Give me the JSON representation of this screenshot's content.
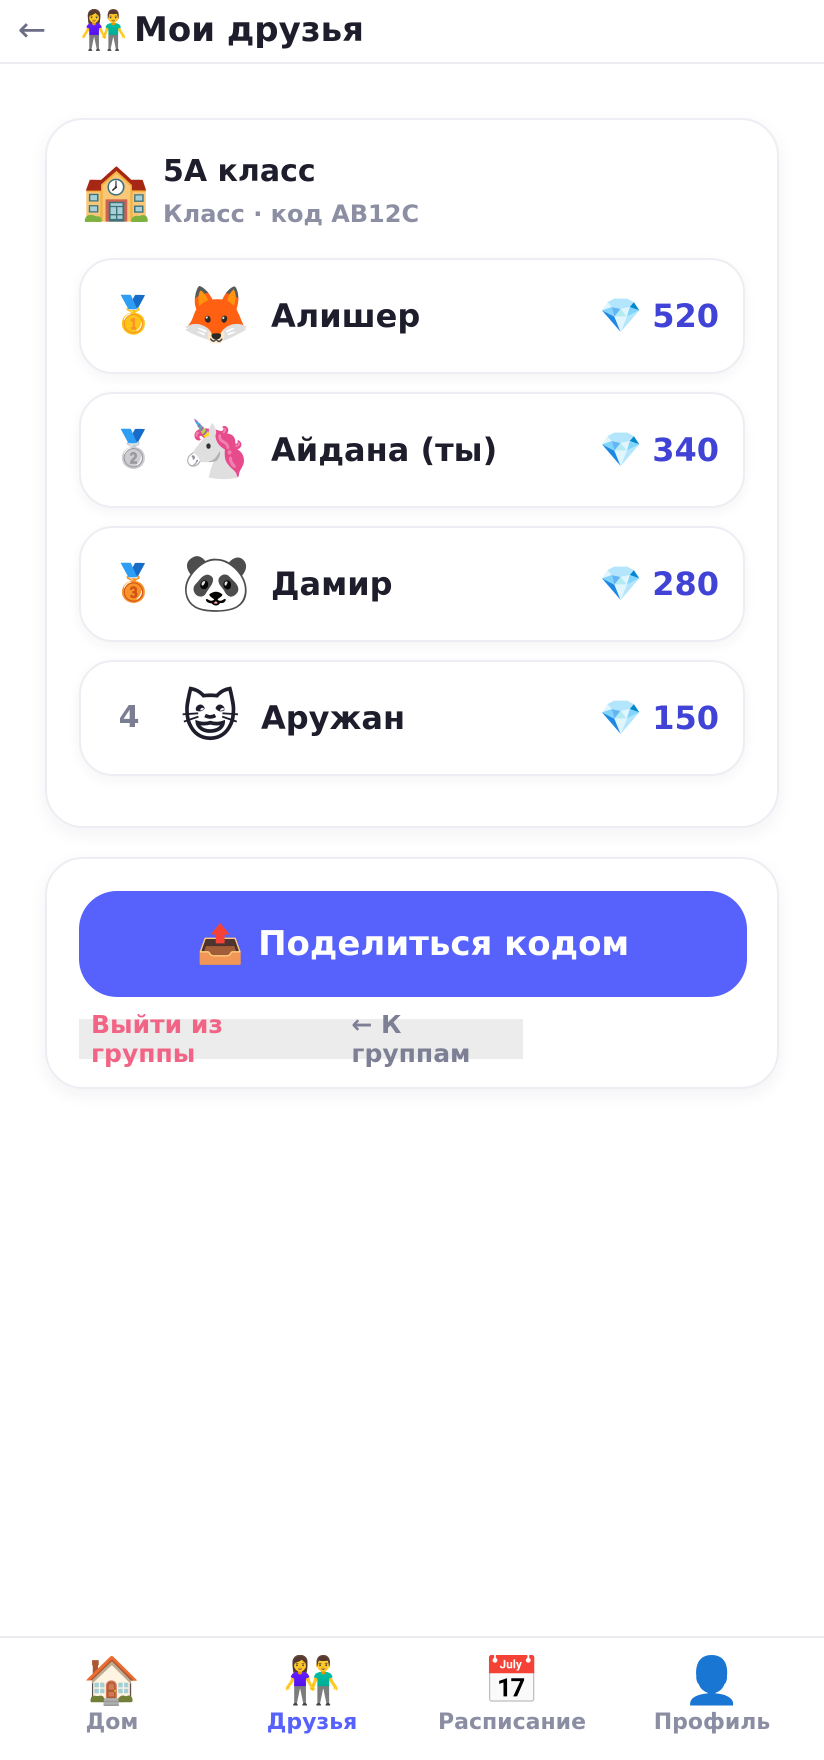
{
  "header": {
    "back_icon": "←",
    "title_icon": "👫",
    "title": "Мои друзья"
  },
  "group": {
    "icon": "🏫",
    "name": "5А класс",
    "subtitle": "Класс · код AB12C"
  },
  "leaderboard": [
    {
      "rank": "🥇",
      "rank_icon_name": "gold-medal-icon",
      "avatar": "🦊",
      "name": "Алишер",
      "gem": "💎",
      "score": "520"
    },
    {
      "rank": "🥈",
      "rank_icon_name": "silver-medal-icon",
      "avatar": "🦄",
      "name": "Айдана (ты)",
      "gem": "💎",
      "score": "340"
    },
    {
      "rank": "🥉",
      "rank_icon_name": "bronze-medal-icon",
      "avatar": "🐼",
      "name": "Дамир",
      "gem": "💎",
      "score": "280"
    },
    {
      "rank": "4",
      "avatar": "😺",
      "name": "Аружан",
      "gem": "💎",
      "score": "150"
    }
  ],
  "actions": {
    "share_icon": "📤",
    "share_label": "Поделиться кодом",
    "leave_label": "Выйти из группы",
    "back_label": "← К группам"
  },
  "nav": {
    "items": [
      {
        "icon": "🏠",
        "label": "Дом"
      },
      {
        "icon": "👫",
        "label": "Друзья",
        "active": true
      },
      {
        "icon": "📅",
        "label": "Расписание"
      },
      {
        "icon": "👤",
        "label": "Профиль"
      }
    ]
  },
  "colors": {
    "accent": "#5662fb",
    "score": "#4043d6",
    "danger": "#f26485",
    "muted": "#8c8fa3"
  }
}
